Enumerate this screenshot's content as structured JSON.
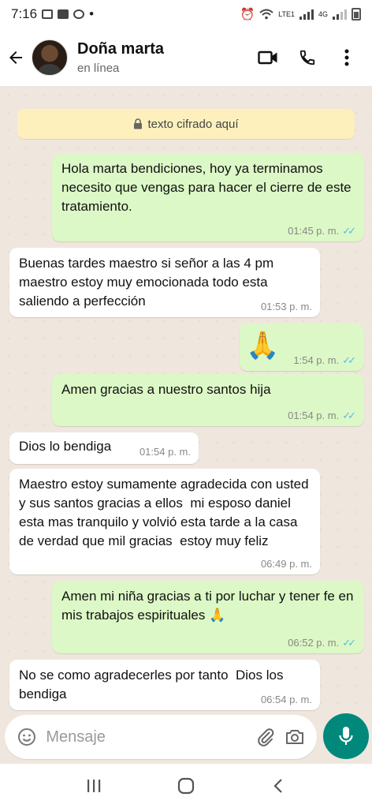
{
  "status_bar": {
    "time": "7:16",
    "dot": "•",
    "net_label": "4G",
    "lte_label": "LTE1"
  },
  "header": {
    "contact_name": "Doña marta",
    "contact_status": "en línea"
  },
  "chat": {
    "encryption_notice": "texto cifrado aquí",
    "messages": [
      {
        "direction": "out",
        "text": "Hola marta bendiciones, hoy ya terminamos necesito que vengas para hacer el cierre de este tratamiento.",
        "time": "01:45 p. m.",
        "read": true
      },
      {
        "direction": "in",
        "text": "Buenas tardes maestro si señor a las 4 pm  maestro estoy muy emocionada todo esta saliendo a perfección",
        "time": "01:53 p. m."
      },
      {
        "direction": "out",
        "text": "🙏",
        "time": "1:54 p. m.",
        "read": true
      },
      {
        "direction": "out",
        "text": "Amen gracias a nuestro santos hija",
        "time": "01:54 p. m.",
        "read": true
      },
      {
        "direction": "in",
        "text": "Dios lo bendiga",
        "time": "01:54 p. m."
      },
      {
        "direction": "in",
        "text": "Maestro estoy sumamente agradecida con usted y sus santos gracias a ellos  mi esposo daniel esta mas tranquilo y volvió esta tarde a la casa  de verdad que mil gracias  estoy muy feliz",
        "time": "06:49 p. m."
      },
      {
        "direction": "out",
        "text": "Amen mi niña gracias a ti por luchar y tener fe en mis trabajos espirituales 🙏",
        "time": "06:52 p. m.",
        "read": true
      },
      {
        "direction": "in",
        "text": "No se como agradecerles por tanto  Dios los bendiga",
        "time": "06:54 p. m."
      }
    ]
  },
  "composer": {
    "placeholder": "Mensaje"
  },
  "icons": {
    "back": "arrow-left-icon",
    "video": "video-call-icon",
    "call": "phone-icon",
    "menu": "more-vertical-icon",
    "lock": "lock-icon",
    "emoji": "emoji-icon",
    "attach": "paperclip-icon",
    "camera": "camera-icon",
    "mic": "microphone-icon",
    "nav_recents": "recents-icon",
    "nav_home": "home-icon",
    "nav_back": "nav-back-icon"
  },
  "colors": {
    "chat_background": "#efe7de",
    "outgoing_bubble": "#dcf8c6",
    "incoming_bubble": "#ffffff",
    "encryption_banner": "#fdf0bd",
    "read_ticks": "#53bdeb",
    "accent": "#00897b"
  }
}
